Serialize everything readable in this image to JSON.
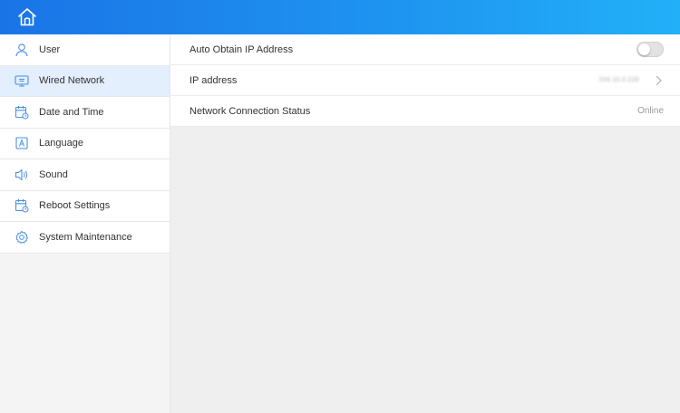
{
  "colors": {
    "topbar_start": "#1a74e6",
    "topbar_end": "#22b0f8",
    "accent": "#3d8fe6",
    "active_bg": "#e3effd"
  },
  "topbar": {
    "home_icon": "home-icon"
  },
  "sidebar": {
    "items": [
      {
        "label": "User",
        "icon": "user-icon",
        "active": false
      },
      {
        "label": "Wired Network",
        "icon": "network-icon",
        "active": true
      },
      {
        "label": "Date and Time",
        "icon": "calendar-clock-icon",
        "active": false
      },
      {
        "label": "Language",
        "icon": "language-icon",
        "active": false
      },
      {
        "label": "Sound",
        "icon": "speaker-icon",
        "active": false
      },
      {
        "label": "Reboot Settings",
        "icon": "calendar-clock-icon",
        "active": false
      },
      {
        "label": "System Maintenance",
        "icon": "gear-icon",
        "active": false
      }
    ]
  },
  "main": {
    "auto_ip": {
      "label": "Auto Obtain IP Address",
      "enabled": false
    },
    "ip_address": {
      "label": "IP address",
      "value": "204.10.0.220"
    },
    "connection_status": {
      "label": "Network Connection Status",
      "value": "Online"
    }
  }
}
